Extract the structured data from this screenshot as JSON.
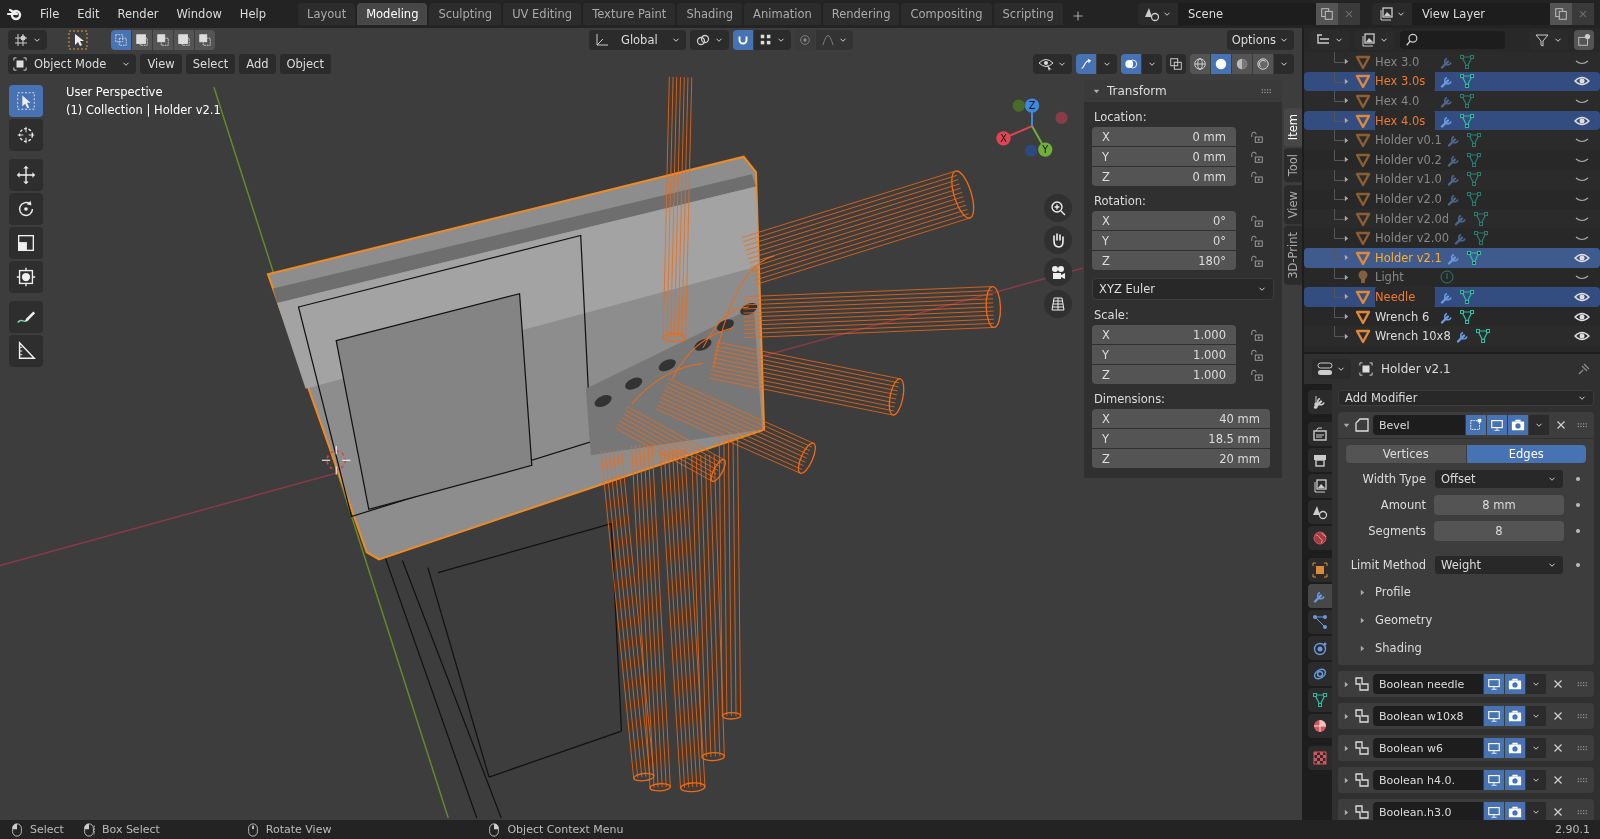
{
  "menu": [
    "File",
    "Edit",
    "Render",
    "Window",
    "Help"
  ],
  "workspaces": [
    {
      "label": "Layout",
      "selected": false
    },
    {
      "label": "Modeling",
      "selected": true
    },
    {
      "label": "Sculpting",
      "selected": false
    },
    {
      "label": "UV Editing",
      "selected": false
    },
    {
      "label": "Texture Paint",
      "selected": false
    },
    {
      "label": "Shading",
      "selected": false
    },
    {
      "label": "Animation",
      "selected": false
    },
    {
      "label": "Rendering",
      "selected": false
    },
    {
      "label": "Compositing",
      "selected": false
    },
    {
      "label": "Scripting",
      "selected": false
    }
  ],
  "scene": "Scene",
  "view_layer": "View Layer",
  "viewport": {
    "select_modes": [
      {
        "selected": true
      },
      {
        "selected": false
      },
      {
        "selected": false
      },
      {
        "selected": false
      },
      {
        "selected": false
      }
    ],
    "orientation": "Global",
    "options": "Options",
    "mode": "Object Mode",
    "menus": [
      "View",
      "Select",
      "Add",
      "Object"
    ],
    "shading": [
      {
        "kind": "wireframe",
        "selected": false
      },
      {
        "kind": "solid",
        "selected": true
      },
      {
        "kind": "material",
        "selected": false
      },
      {
        "kind": "rendered",
        "selected": false
      }
    ],
    "tools": [
      {
        "kind": "select",
        "selected": true
      },
      {
        "kind": "cursor",
        "selected": false
      },
      {
        "kind": "move",
        "selected": false
      },
      {
        "kind": "rotate",
        "selected": false
      },
      {
        "kind": "scale",
        "selected": false
      },
      {
        "kind": "transform",
        "selected": false
      },
      {
        "kind": "annotate",
        "selected": false
      },
      {
        "kind": "measure",
        "selected": false
      }
    ],
    "overlay_text": [
      "User Perspective",
      "(1) Collection | Holder v2.1"
    ],
    "gizmo_axes": [
      "X",
      "Y",
      "Z"
    ],
    "sidebar_tabs": [
      {
        "label": "Item",
        "selected": true
      },
      {
        "label": "Tool",
        "selected": false
      },
      {
        "label": "View",
        "selected": false
      },
      {
        "label": "3D-Print",
        "selected": false
      }
    ],
    "transform": {
      "title": "Transform",
      "location": {
        "label": "Location:",
        "rows": [
          {
            "axis": "X",
            "value": "0 mm",
            "locked": false
          },
          {
            "axis": "Y",
            "value": "0 mm",
            "locked": false
          },
          {
            "axis": "Z",
            "value": "0 mm",
            "locked": false
          }
        ]
      },
      "rotation": {
        "label": "Rotation:",
        "rows": [
          {
            "axis": "X",
            "value": "0°",
            "locked": false
          },
          {
            "axis": "Y",
            "value": "0°",
            "locked": false
          },
          {
            "axis": "Z",
            "value": "180°",
            "locked": false
          }
        ]
      },
      "rotation_mode": "XYZ Euler",
      "scale": {
        "label": "Scale:",
        "rows": [
          {
            "axis": "X",
            "value": "1.000",
            "locked": false
          },
          {
            "axis": "Y",
            "value": "1.000",
            "locked": false
          },
          {
            "axis": "Z",
            "value": "1.000",
            "locked": false
          }
        ]
      },
      "dimensions": {
        "label": "Dimensions:",
        "rows": [
          {
            "axis": "X",
            "value": "40 mm"
          },
          {
            "axis": "Y",
            "value": "18.5 mm"
          },
          {
            "axis": "Z",
            "value": "20 mm"
          }
        ]
      }
    }
  },
  "outliner": {
    "items": [
      {
        "name": "Hex 3.0",
        "kind": "mesh",
        "visible": false,
        "selected": false,
        "active": false
      },
      {
        "name": "Hex 3.0s",
        "kind": "mesh",
        "visible": true,
        "selected": true,
        "active": false
      },
      {
        "name": "Hex 4.0",
        "kind": "mesh",
        "visible": false,
        "selected": false,
        "active": false
      },
      {
        "name": "Hex 4.0s",
        "kind": "mesh",
        "visible": true,
        "selected": true,
        "active": false
      },
      {
        "name": "Holder v0.1",
        "kind": "mesh",
        "visible": false,
        "selected": false,
        "active": false
      },
      {
        "name": "Holder v0.2",
        "kind": "mesh",
        "visible": false,
        "selected": false,
        "active": false
      },
      {
        "name": "Holder v1.0",
        "kind": "mesh",
        "visible": false,
        "selected": false,
        "active": false
      },
      {
        "name": "Holder v2.0",
        "kind": "mesh",
        "visible": false,
        "selected": false,
        "active": false
      },
      {
        "name": "Holder v2.0d",
        "kind": "mesh",
        "visible": false,
        "selected": false,
        "active": false
      },
      {
        "name": "Holder v2.00",
        "kind": "mesh",
        "visible": false,
        "selected": false,
        "active": false
      },
      {
        "name": "Holder v2.1",
        "kind": "mesh",
        "visible": true,
        "selected": true,
        "active": true
      },
      {
        "name": "Light",
        "kind": "light",
        "visible": false,
        "selected": false,
        "active": false
      },
      {
        "name": "Needle",
        "kind": "mesh",
        "visible": true,
        "selected": true,
        "active": false
      },
      {
        "name": "Wrench 6",
        "kind": "mesh",
        "visible": true,
        "selected": false,
        "active": false
      },
      {
        "name": "Wrench 10x8",
        "kind": "mesh",
        "visible": true,
        "selected": false,
        "active": false
      }
    ]
  },
  "properties": {
    "object_name": "Holder v2.1",
    "tabs": [
      {
        "kind": "tool",
        "selected": false
      },
      {
        "kind": "render",
        "selected": false
      },
      {
        "kind": "output",
        "selected": false
      },
      {
        "kind": "view_layer",
        "selected": false
      },
      {
        "kind": "scene",
        "selected": false
      },
      {
        "kind": "world",
        "selected": false
      },
      {
        "kind": "object",
        "selected": false
      },
      {
        "kind": "modifiers",
        "selected": true
      },
      {
        "kind": "particles",
        "selected": false
      },
      {
        "kind": "physics",
        "selected": false
      },
      {
        "kind": "constraints",
        "selected": false
      },
      {
        "kind": "data",
        "selected": false
      },
      {
        "kind": "material",
        "selected": false
      },
      {
        "kind": "texture",
        "selected": false
      }
    ],
    "add_modifier": "Add Modifier",
    "modifiers": [
      {
        "kind": "bevel",
        "name": "Bevel",
        "expanded": true,
        "affect": [
          {
            "label": "Vertices",
            "selected": false
          },
          {
            "label": "Edges",
            "selected": true
          }
        ],
        "settings": [
          {
            "label": "Width Type",
            "value": "Offset",
            "kind": "dropdown"
          },
          {
            "label": "Amount",
            "value": "8 mm",
            "kind": "number"
          },
          {
            "label": "Segments",
            "value": "8",
            "kind": "number"
          },
          {
            "label": "Limit Method",
            "value": "Weight",
            "kind": "dropdown"
          }
        ],
        "subpanels": [
          {
            "label": "Profile",
            "expanded": false
          },
          {
            "label": "Geometry",
            "expanded": false
          },
          {
            "label": "Shading",
            "expanded": false
          }
        ]
      },
      {
        "kind": "boolean",
        "name": "Boolean needle",
        "expanded": false
      },
      {
        "kind": "boolean",
        "name": "Boolean w10x8",
        "expanded": false
      },
      {
        "kind": "boolean",
        "name": "Boolean w6",
        "expanded": false
      },
      {
        "kind": "boolean",
        "name": "Boolean h4.0.",
        "expanded": false
      },
      {
        "kind": "boolean",
        "name": "Boolean.h3.0",
        "expanded": false
      }
    ]
  },
  "status_bar": {
    "hints": [
      {
        "kind": "left",
        "label": "Select"
      },
      {
        "kind": "drag",
        "label": "Box Select"
      },
      {
        "kind": "middle",
        "label": "Rotate View"
      },
      {
        "kind": "right",
        "label": "Object Context Menu"
      }
    ],
    "version": "2.90.1"
  }
}
